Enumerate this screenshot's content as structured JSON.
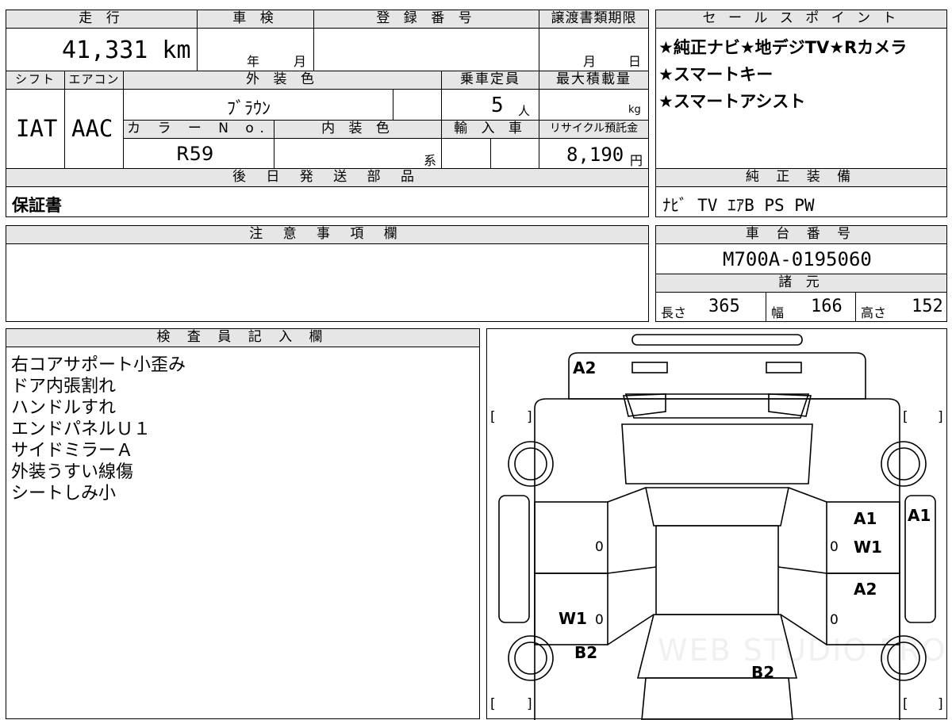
{
  "headers": {
    "mileage": "走 行",
    "inspection": "車 検",
    "registration": "登 録 番 号",
    "transfer_deadline": "譲渡書類期限",
    "sales_points": "セ ー ル ス ポ イ ン ト",
    "shift": "シフト",
    "aircon": "エアコン",
    "exterior_color": "外 装 色",
    "capacity": "乗車定員",
    "max_load": "最大積載量",
    "color_no": "カ ラ ー N o.",
    "interior_color": "内 装 色",
    "import": "輸 入 車",
    "recycle_fee": "リサイクル預託金",
    "later_parts": "後 日 発 送 部 品",
    "genuine_equipment": "純 正 装 備",
    "notes": "注 意 事 項 欄",
    "chassis_no": "車 台 番 号",
    "specs": "諸 元",
    "inspector": "検 査 員 記 入 欄"
  },
  "values": {
    "mileage": "41,331 km",
    "inspection_year": "年",
    "inspection_month": "月",
    "transfer_month": "月",
    "transfer_day": "日",
    "shift": "IAT",
    "aircon": "AAC",
    "exterior_color": "ﾌﾞﾗｳﾝ",
    "capacity": "5",
    "capacity_unit": "人",
    "load_unit": "kg",
    "color_no": "R59",
    "interior_suffix": "系",
    "recycle_fee": "8,190",
    "recycle_unit": "円",
    "later_parts": "保証書",
    "genuine_equipment": "ﾅﾋﾞ TV ｴｱB PS PW",
    "chassis_no": "M700A-0195060",
    "length_label": "長さ",
    "length": "365",
    "width_label": "幅",
    "width": "166",
    "height_label": "高さ",
    "height": "152"
  },
  "sales_points": [
    "★純正ナビ★地デジTV★Rカメラ",
    "★スマートキー",
    "★スマートアシスト"
  ],
  "inspector_notes": [
    "右コアサポート小歪み",
    "ドア内張割れ",
    "ハンドルすれ",
    "エンドパネルＵ１",
    "サイドミラーＡ",
    "外装うすい線傷",
    "シートしみ小"
  ],
  "diagram_marks": {
    "rear_a2": "A2",
    "right_mirror_a1": "A1",
    "right_front_door_a1": "A1",
    "right_front_door_w1": "W1",
    "right_rear_door_a2": "A2",
    "left_rear_door_w1": "W1",
    "left_rear_b2": "B2",
    "front_b2": "B2",
    "zero": "0",
    "bracket_left": "[",
    "bracket_right": "]"
  },
  "watermark": "WEB STUDIO PRO"
}
